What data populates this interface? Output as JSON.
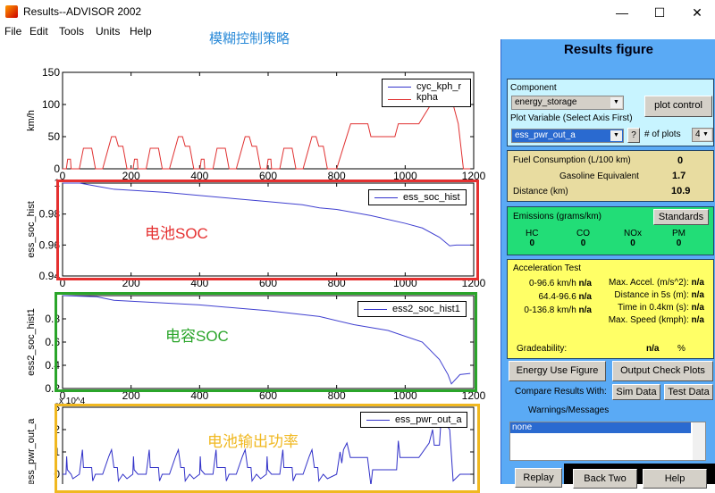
{
  "window": {
    "title": "Results--ADVISOR 2002",
    "minimize": "—",
    "maximize": "☐",
    "close": "✕"
  },
  "menu": [
    "File",
    "Edit",
    "Tools",
    "Units",
    "Help"
  ],
  "caption": "模糊控制策略",
  "annotations": {
    "battery_soc": "电池SOC",
    "cap_soc": "电容SOC",
    "battery_power": "电池输出功率"
  },
  "colors": {
    "red": "#e53030",
    "green": "#2aa52a",
    "yellow": "#f0b820",
    "panel": "#5aaaf5"
  },
  "chart_data": [
    {
      "type": "line",
      "ylabel": "km/h",
      "xlim": [
        0,
        1200
      ],
      "ylim": [
        0,
        150
      ],
      "xticks": [
        0,
        200,
        400,
        600,
        800,
        1000,
        1200
      ],
      "yticks": [
        0,
        50,
        100,
        150
      ],
      "legend": {
        "entries": [
          "cyc_kph_r",
          "kpha"
        ],
        "placement": "top-right"
      },
      "series": [
        {
          "name": "kpha",
          "color": "#e03030",
          "points": [
            [
              0,
              0
            ],
            [
              11,
              0
            ],
            [
              15,
              15
            ],
            [
              23,
              15
            ],
            [
              25,
              0
            ],
            [
              49,
              0
            ],
            [
              61,
              32
            ],
            [
              85,
              32
            ],
            [
              96,
              0
            ],
            [
              117,
              0
            ],
            [
              143,
              50
            ],
            [
              155,
              50
            ],
            [
              163,
              35
            ],
            [
              176,
              35
            ],
            [
              188,
              0
            ],
            [
              206,
              0
            ],
            [
              210,
              15
            ],
            [
              218,
              15
            ],
            [
              220,
              0
            ],
            [
              244,
              0
            ],
            [
              256,
              32
            ],
            [
              280,
              32
            ],
            [
              291,
              0
            ],
            [
              312,
              0
            ],
            [
              338,
              50
            ],
            [
              350,
              50
            ],
            [
              358,
              35
            ],
            [
              371,
              35
            ],
            [
              383,
              0
            ],
            [
              401,
              0
            ],
            [
              405,
              15
            ],
            [
              413,
              15
            ],
            [
              415,
              0
            ],
            [
              439,
              0
            ],
            [
              451,
              32
            ],
            [
              475,
              32
            ],
            [
              486,
              0
            ],
            [
              507,
              0
            ],
            [
              533,
              50
            ],
            [
              545,
              50
            ],
            [
              553,
              35
            ],
            [
              566,
              35
            ],
            [
              578,
              0
            ],
            [
              596,
              0
            ],
            [
              600,
              15
            ],
            [
              608,
              15
            ],
            [
              610,
              0
            ],
            [
              634,
              0
            ],
            [
              646,
              32
            ],
            [
              670,
              32
            ],
            [
              681,
              0
            ],
            [
              702,
              0
            ],
            [
              728,
              50
            ],
            [
              740,
              50
            ],
            [
              748,
              35
            ],
            [
              761,
              35
            ],
            [
              773,
              0
            ],
            [
              800,
              0
            ],
            [
              841,
              70
            ],
            [
              891,
              70
            ],
            [
              900,
              50
            ],
            [
              970,
              50
            ],
            [
              980,
              70
            ],
            [
              1040,
              70
            ],
            [
              1075,
              100
            ],
            [
              1125,
              100
            ],
            [
              1140,
              100
            ],
            [
              1155,
              70
            ],
            [
              1170,
              0
            ],
            [
              1190,
              0
            ]
          ]
        }
      ]
    },
    {
      "type": "line",
      "ylabel": "ess_soc_hist",
      "xlim": [
        0,
        1200
      ],
      "ylim": [
        0.94,
        1.0
      ],
      "xticks": [
        0,
        200,
        400,
        600,
        800,
        1000,
        1200
      ],
      "yticks": [
        0.94,
        0.96,
        0.98,
        1
      ],
      "legend": {
        "entries": [
          "ess_soc_hist"
        ],
        "placement": "top-right"
      },
      "series": [
        {
          "name": "ess_soc_hist",
          "color": "#4040d0",
          "points": [
            [
              0,
              1.0
            ],
            [
              50,
              1.0
            ],
            [
              100,
              0.998
            ],
            [
              150,
              0.996
            ],
            [
              300,
              0.994
            ],
            [
              500,
              0.99
            ],
            [
              600,
              0.988
            ],
            [
              700,
              0.986
            ],
            [
              750,
              0.984
            ],
            [
              800,
              0.983
            ],
            [
              900,
              0.979
            ],
            [
              1000,
              0.974
            ],
            [
              1050,
              0.971
            ],
            [
              1100,
              0.965
            ],
            [
              1130,
              0.9595
            ],
            [
              1150,
              0.96
            ],
            [
              1190,
              0.96
            ]
          ]
        }
      ]
    },
    {
      "type": "line",
      "ylabel": "ess2_soc_hist1",
      "xlim": [
        0,
        1200
      ],
      "ylim": [
        0.2,
        1.0
      ],
      "xticks": [
        0,
        200,
        400,
        600,
        800,
        1000,
        1200
      ],
      "yticks": [
        0.2,
        0.4,
        0.6,
        0.8
      ],
      "legend": {
        "entries": [
          "ess2_soc_hist1"
        ],
        "placement": "top-right"
      },
      "series": [
        {
          "name": "ess2_soc_hist1",
          "color": "#4040d0",
          "points": [
            [
              0,
              1.0
            ],
            [
              100,
              0.99
            ],
            [
              150,
              0.96
            ],
            [
              400,
              0.92
            ],
            [
              600,
              0.87
            ],
            [
              750,
              0.82
            ],
            [
              850,
              0.75
            ],
            [
              950,
              0.7
            ],
            [
              1050,
              0.6
            ],
            [
              1100,
              0.45
            ],
            [
              1125,
              0.32
            ],
            [
              1135,
              0.24
            ],
            [
              1160,
              0.32
            ],
            [
              1190,
              0.33
            ]
          ]
        }
      ]
    },
    {
      "type": "line",
      "ylabel": "ess_pwr_out_a",
      "yscale_label": "x 10^4",
      "xlim": [
        0,
        1200
      ],
      "ylim": [
        -1,
        3
      ],
      "yticks": [
        0,
        1,
        2,
        3
      ],
      "legend": {
        "entries": [
          "ess_pwr_out_a"
        ],
        "placement": "top-right"
      },
      "series": [
        {
          "name": "ess_pwr_out_a",
          "color": "#3030c8",
          "points": [
            [
              0,
              0
            ],
            [
              10,
              0
            ],
            [
              12,
              0.8
            ],
            [
              14,
              0.2
            ],
            [
              25,
              0
            ],
            [
              30,
              -0.2
            ],
            [
              49,
              0
            ],
            [
              58,
              1.1
            ],
            [
              61,
              0.3
            ],
            [
              85,
              0.3
            ],
            [
              88,
              -0.3
            ],
            [
              96,
              0
            ],
            [
              117,
              0
            ],
            [
              135,
              0.8
            ],
            [
              143,
              1.1
            ],
            [
              150,
              0.3
            ],
            [
              160,
              0.3
            ],
            [
              163,
              -0.3
            ],
            [
              176,
              0
            ],
            [
              188,
              -0.2
            ],
            [
              205,
              0
            ],
            [
              207,
              0.8
            ],
            [
              209,
              0.2
            ],
            [
              220,
              0
            ],
            [
              244,
              0
            ],
            [
              253,
              1.1
            ],
            [
              256,
              0.3
            ],
            [
              280,
              0.3
            ],
            [
              283,
              -0.3
            ],
            [
              291,
              0
            ],
            [
              312,
              0
            ],
            [
              330,
              0.8
            ],
            [
              338,
              1.1
            ],
            [
              345,
              0.3
            ],
            [
              355,
              0.3
            ],
            [
              358,
              -0.3
            ],
            [
              371,
              0
            ],
            [
              383,
              -0.2
            ],
            [
              400,
              0
            ],
            [
              402,
              0.8
            ],
            [
              404,
              0.2
            ],
            [
              415,
              0
            ],
            [
              439,
              0
            ],
            [
              448,
              1.1
            ],
            [
              451,
              0.3
            ],
            [
              475,
              0.3
            ],
            [
              478,
              -0.3
            ],
            [
              486,
              0
            ],
            [
              507,
              0
            ],
            [
              525,
              0.8
            ],
            [
              533,
              1.1
            ],
            [
              540,
              0.3
            ],
            [
              550,
              0.3
            ],
            [
              553,
              -0.3
            ],
            [
              566,
              0
            ],
            [
              578,
              -0.2
            ],
            [
              595,
              0
            ],
            [
              597,
              0.8
            ],
            [
              599,
              0.2
            ],
            [
              610,
              0
            ],
            [
              634,
              0
            ],
            [
              643,
              1.1
            ],
            [
              646,
              0.3
            ],
            [
              670,
              0.3
            ],
            [
              673,
              -0.3
            ],
            [
              681,
              0
            ],
            [
              702,
              0
            ],
            [
              720,
              0.8
            ],
            [
              728,
              1.1
            ],
            [
              735,
              0.3
            ],
            [
              745,
              0.3
            ],
            [
              748,
              -0.3
            ],
            [
              761,
              0
            ],
            [
              773,
              -0.2
            ],
            [
              800,
              0
            ],
            [
              810,
              1.0
            ],
            [
              815,
              0.5
            ],
            [
              820,
              1.1
            ],
            [
              830,
              1.4
            ],
            [
              840,
              0.75
            ],
            [
              890,
              0.75
            ],
            [
              900,
              -0.5
            ],
            [
              905,
              0.2
            ],
            [
              975,
              0.2
            ],
            [
              980,
              1.5
            ],
            [
              985,
              0.75
            ],
            [
              1040,
              0.75
            ],
            [
              1070,
              1.4
            ],
            [
              1080,
              2.0
            ],
            [
              1085,
              1.3
            ],
            [
              1100,
              1.3
            ],
            [
              1105,
              2.5
            ],
            [
              1130,
              2.0
            ],
            [
              1140,
              -0.3
            ],
            [
              1160,
              0
            ],
            [
              1190,
              0
            ]
          ]
        }
      ]
    }
  ],
  "panel": {
    "title": "Results figure",
    "component_label": "Component",
    "component_value": "energy_storage",
    "plot_control": "plot control",
    "plot_variable_label": "Plot Variable (Select Axis First)",
    "plot_variable_value": "ess_pwr_out_a",
    "help_q": "?",
    "num_plots_label": "# of plots",
    "num_plots_value": "4",
    "fuel_label": "Fuel Consumption (L/100 km)",
    "fuel_value": "0",
    "gas_label": "Gasoline Equivalent",
    "gas_value": "1.7",
    "distance_label": "Distance (km)",
    "distance_value": "10.9",
    "emissions_label": "Emissions (grams/km)",
    "standards": "Standards",
    "emissions": [
      {
        "name": "HC",
        "value": "0"
      },
      {
        "name": "CO",
        "value": "0"
      },
      {
        "name": "NOx",
        "value": "0"
      },
      {
        "name": "PM",
        "value": "0"
      }
    ],
    "accel_title": "Acceleration Test",
    "accel_left": [
      {
        "label": "0-96.6 km/h",
        "value": "n/a"
      },
      {
        "label": "64.4-96.6",
        "value": "n/a"
      },
      {
        "label": "0-136.8 km/h",
        "value": "n/a"
      }
    ],
    "accel_right": [
      {
        "label": "Max. Accel. (m/s^2):",
        "value": "n/a"
      },
      {
        "label": "Distance in 5s (m):",
        "value": "n/a"
      },
      {
        "label": "Time in 0.4km (s):",
        "value": "n/a"
      },
      {
        "label": "Max. Speed (kmph):",
        "value": "n/a"
      }
    ],
    "grade_label": "Gradeability:",
    "grade_value": "n/a",
    "grade_unit": "%",
    "energy_use": "Energy Use Figure",
    "output_check": "Output Check Plots",
    "compare_label": "Compare Results With:",
    "sim_data": "Sim Data",
    "test_data": "Test Data",
    "warnings_label": "Warnings/Messages",
    "warnings": [
      "none"
    ],
    "replay": "Replay",
    "back_two": "Back Two",
    "help": "Help"
  }
}
